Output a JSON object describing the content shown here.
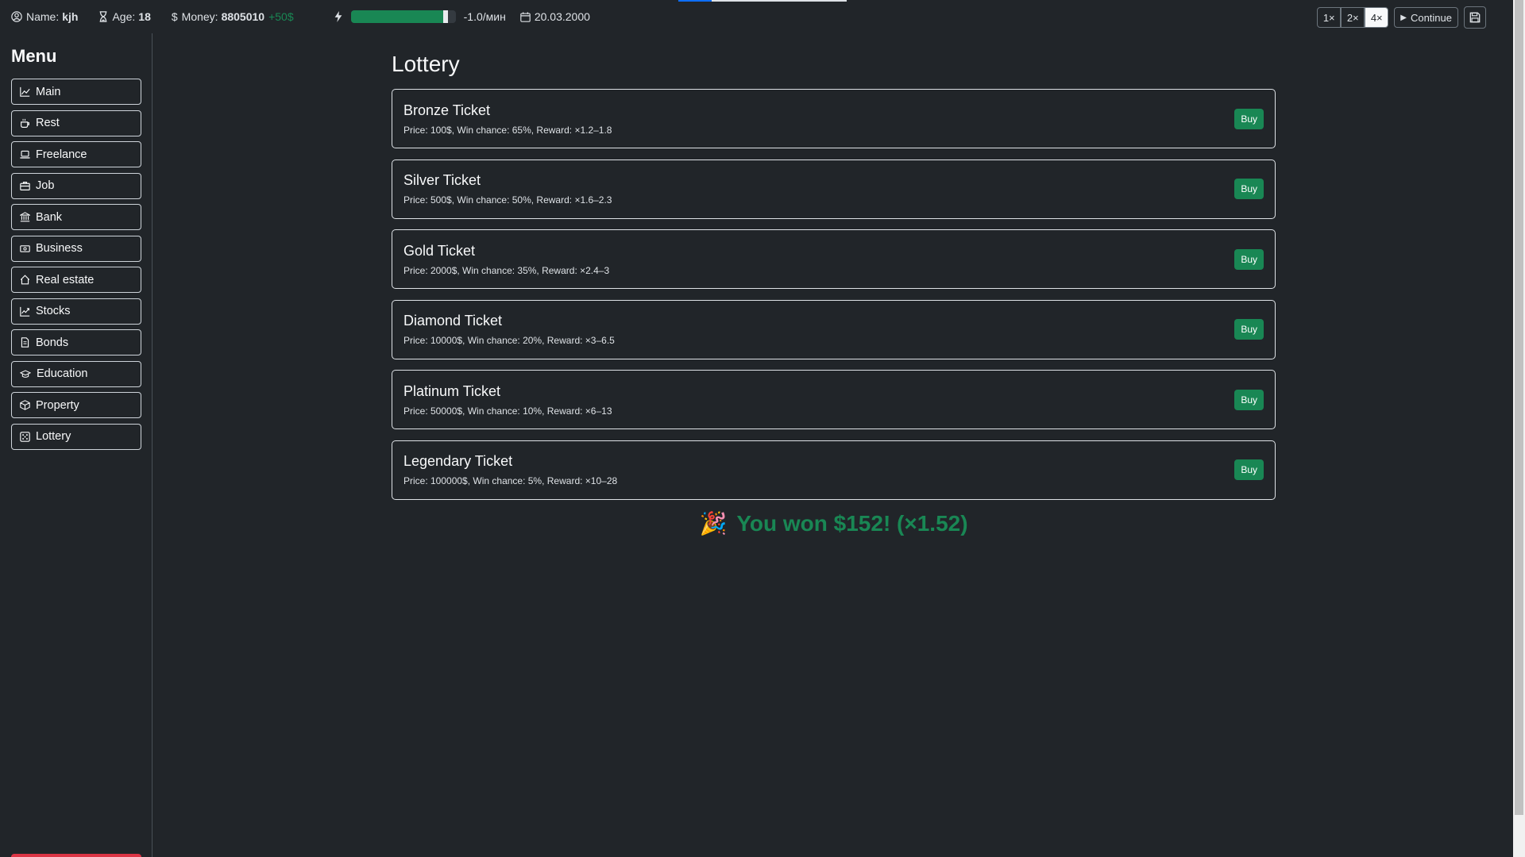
{
  "header": {
    "name_label": "Name:",
    "name_value": "kjh",
    "age_label": "Age:",
    "age_value": "18",
    "money_label": "Money:",
    "money_value": "8805010",
    "money_delta": "+50$",
    "energy_level_percent": 93,
    "energy_rate": "-1.0/мин",
    "date": "20.03.2000"
  },
  "controls": {
    "speeds": [
      "1×",
      "2×",
      "4×"
    ],
    "active_speed": "4×",
    "continue_label": "Continue"
  },
  "sidebar": {
    "title": "Menu",
    "items": [
      {
        "label": "Main",
        "icon": "chart-line-icon"
      },
      {
        "label": "Rest",
        "icon": "coffee-icon"
      },
      {
        "label": "Freelance",
        "icon": "laptop-icon"
      },
      {
        "label": "Job",
        "icon": "briefcase-icon"
      },
      {
        "label": "Bank",
        "icon": "bank-icon"
      },
      {
        "label": "Business",
        "icon": "cash-icon"
      },
      {
        "label": "Real estate",
        "icon": "house-icon"
      },
      {
        "label": "Stocks",
        "icon": "graph-up-icon"
      },
      {
        "label": "Bonds",
        "icon": "document-icon"
      },
      {
        "label": "Education",
        "icon": "mortarboard-icon"
      },
      {
        "label": "Property",
        "icon": "box-icon"
      },
      {
        "label": "Lottery",
        "icon": "dice-icon"
      }
    ]
  },
  "main": {
    "title": "Lottery",
    "buy_label": "Buy",
    "tickets": [
      {
        "name": "Bronze Ticket",
        "desc": "Price: 100$, Win chance: 65%, Reward: ×1.2–1.8"
      },
      {
        "name": "Silver Ticket",
        "desc": "Price: 500$, Win chance: 50%, Reward: ×1.6–2.3"
      },
      {
        "name": "Gold Ticket",
        "desc": "Price: 2000$, Win chance: 35%, Reward: ×2.4–3"
      },
      {
        "name": "Diamond Ticket",
        "desc": "Price: 10000$, Win chance: 20%, Reward: ×3–6.5"
      },
      {
        "name": "Platinum Ticket",
        "desc": "Price: 50000$, Win chance: 10%, Reward: ×6–13"
      },
      {
        "name": "Legendary Ticket",
        "desc": "Price: 100000$, Win chance: 5%, Reward: ×10–28"
      }
    ],
    "win_emoji": "🎉",
    "win_message": "You won $152! (×1.52)"
  },
  "colors": {
    "background": "#212529",
    "accent_green": "#198754",
    "danger": "#dc3545"
  }
}
